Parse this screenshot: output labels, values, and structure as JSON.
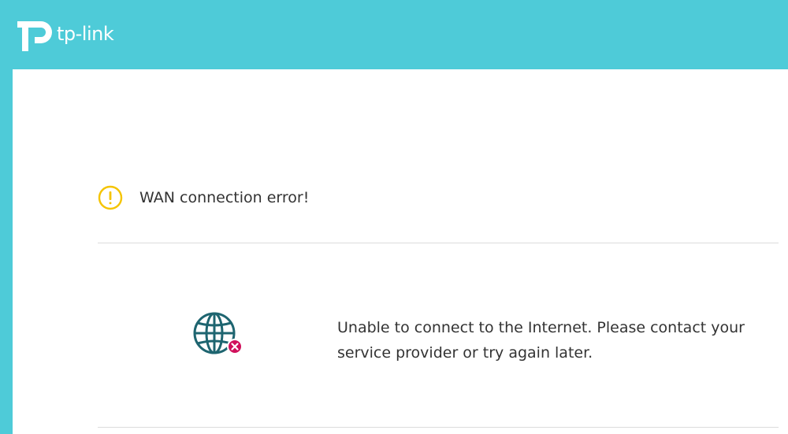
{
  "header": {
    "brand": "tp-link",
    "logo_icon": "tp-link-logo-icon",
    "background_color": "#4ecbd8"
  },
  "alert": {
    "icon": "warning-icon",
    "icon_color": "#f5c400",
    "title": "WAN connection error!"
  },
  "status": {
    "icon": "globe-disconnected-icon",
    "icon_color": "#1e6570",
    "badge_color": "#d0105b",
    "message": "Unable to connect to the Internet. Please contact your service provider or try again later."
  }
}
